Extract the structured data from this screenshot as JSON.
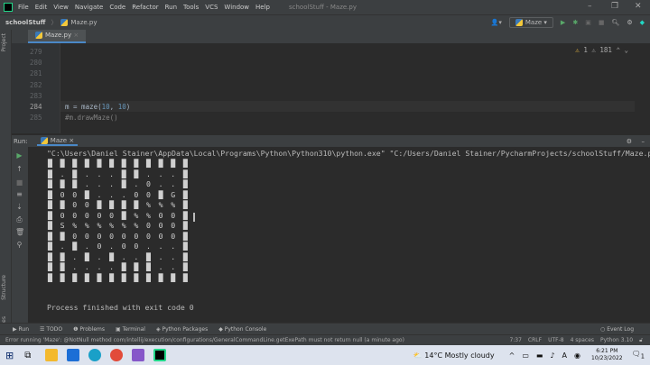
{
  "menu": {
    "items": [
      "File",
      "Edit",
      "View",
      "Navigate",
      "Code",
      "Refactor",
      "Run",
      "Tools",
      "VCS",
      "Window",
      "Help"
    ],
    "title": "schoolStuff - Maze.py"
  },
  "breadcrumb": {
    "project": "schoolStuff",
    "file": "Maze.py"
  },
  "toolbar": {
    "run_config": "Maze"
  },
  "sidebar": {
    "project": "Project",
    "structure": "Structure",
    "favorites": "Favorites"
  },
  "tabs": [
    {
      "label": "Maze.py",
      "close": "×"
    }
  ],
  "editor": {
    "lines": [
      {
        "n": "279",
        "code": ""
      },
      {
        "n": "280",
        "code": ""
      },
      {
        "n": "281",
        "code": ""
      },
      {
        "n": "282",
        "code": ""
      },
      {
        "n": "283",
        "code": ""
      },
      {
        "n": "284",
        "code_pre": "m = maze(",
        "a": "10",
        "sep": ", ",
        "b": "10",
        "post": ")"
      },
      {
        "n": "285",
        "code": "#m.drawMaze()"
      }
    ],
    "warnings": "1",
    "weak_warnings": "181"
  },
  "run": {
    "label": "Run:",
    "tab": "Maze",
    "command": "\"C:\\Users\\Daniel Stainer\\AppData\\Local\\Programs\\Python\\Python310\\python.exe\" \"C:/Users/Daniel Stainer/PycharmProjects/schoolStuff/Maze.py\"",
    "maze": [
      "████████████",
      "█.█...██...█",
      "███...█.0..█",
      "█00█...00█G█",
      "██00████%%%█",
      "█00000█%%00█",
      "█S%%%%%%000█",
      "██000000000█",
      "█.█.0.00...█",
      "██.█.█..█..█",
      "██....███..█",
      "████████████"
    ],
    "finished": "Process finished with exit code 0"
  },
  "toolwindows": [
    "Run",
    "TODO",
    "Problems",
    "Terminal",
    "Python Packages",
    "Python Console",
    "Event Log"
  ],
  "status": {
    "message": "Error running 'Maze': @NotNull method com/intellij/execution/configurations/GeneralCommandLine.getExePath must not return null (a minute ago)",
    "position": "7:37",
    "line_sep": "CRLF",
    "encoding": "UTF-8",
    "indent": "4 spaces",
    "interpreter": "Python 3.10"
  },
  "taskbar": {
    "weather": "14°C  Mostly cloudy",
    "time": "6:21 PM",
    "date": "10/23/2022",
    "notifications": "1"
  }
}
